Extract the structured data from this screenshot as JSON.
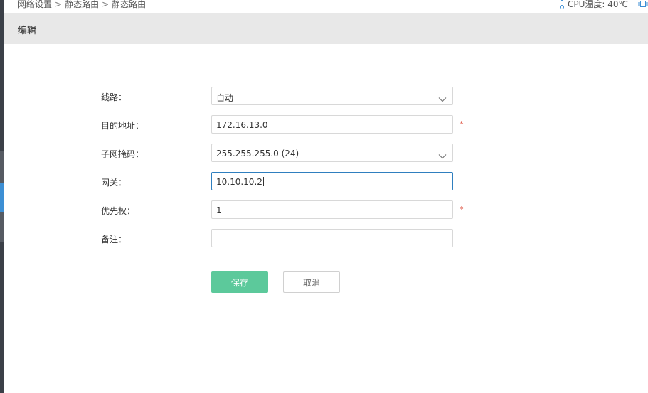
{
  "breadcrumb": {
    "items": [
      "网络设置",
      "静态路由",
      "静态路由"
    ],
    "separator": ">"
  },
  "status": {
    "cpu_temp_label": "CPU温度: 40℃"
  },
  "panel": {
    "title": "编辑"
  },
  "form": {
    "line": {
      "label": "线路：",
      "value": "自动"
    },
    "destination": {
      "label": "目的地址：",
      "value": "172.16.13.0",
      "required_mark": "*"
    },
    "netmask": {
      "label": "子网掩码：",
      "value": "255.255.255.0 (24)"
    },
    "gateway": {
      "label": "网关：",
      "value": "10.10.10.2"
    },
    "priority": {
      "label": "优先权：",
      "value": "1",
      "required_mark": "*"
    },
    "remark": {
      "label": "备注：",
      "value": ""
    }
  },
  "buttons": {
    "save_label": "保存",
    "cancel_label": "取消"
  },
  "colors": {
    "primary_button": "#5cc99b",
    "focus_border": "#2f7fbf",
    "required": "#e05b4b",
    "sidebar_active": "#3d8fd4"
  },
  "icons": {
    "cpu": "thermometer-icon",
    "chip": "chip-icon",
    "dropdown": "chevron-down-icon"
  }
}
